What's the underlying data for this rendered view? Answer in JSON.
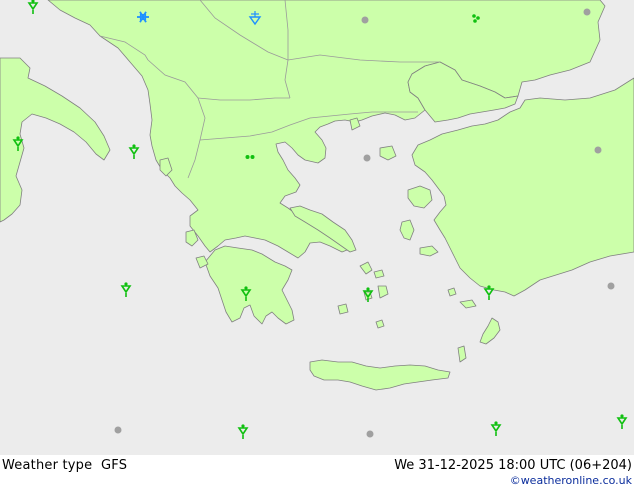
{
  "colors": {
    "sea": "#ececec",
    "land": "#ccffaa",
    "coast": "#808080",
    "border": "#9a9a9a",
    "rain_symbol": "#10c010",
    "snow_symbol": "#1e90ff",
    "cloud_symbol": "#a0a0a0",
    "credit_text": "#0b2d9c"
  },
  "footer": {
    "product": "Weather type  GFS",
    "datetime": "We 31-12-2025 18:00 UTC (06+204)",
    "credit": "©weatheronline.co.uk"
  },
  "symbols": [
    {
      "type": "rain-shower"
    },
    {
      "type": "snow"
    },
    {
      "type": "snow-shower"
    },
    {
      "type": "cloudy"
    },
    {
      "type": "drizzle"
    },
    {
      "type": "cloudy"
    },
    {
      "type": "rain-shower"
    },
    {
      "type": "rain-shower"
    },
    {
      "type": "light-rain"
    },
    {
      "type": "cloudy"
    },
    {
      "type": "cloudy"
    },
    {
      "type": "rain-shower"
    },
    {
      "type": "rain-shower"
    },
    {
      "type": "rain-shower"
    },
    {
      "type": "rain-shower"
    },
    {
      "type": "cloudy"
    },
    {
      "type": "cloudy"
    },
    {
      "type": "rain-shower"
    },
    {
      "type": "cloudy"
    },
    {
      "type": "rain-shower"
    },
    {
      "type": "rain-shower"
    }
  ]
}
